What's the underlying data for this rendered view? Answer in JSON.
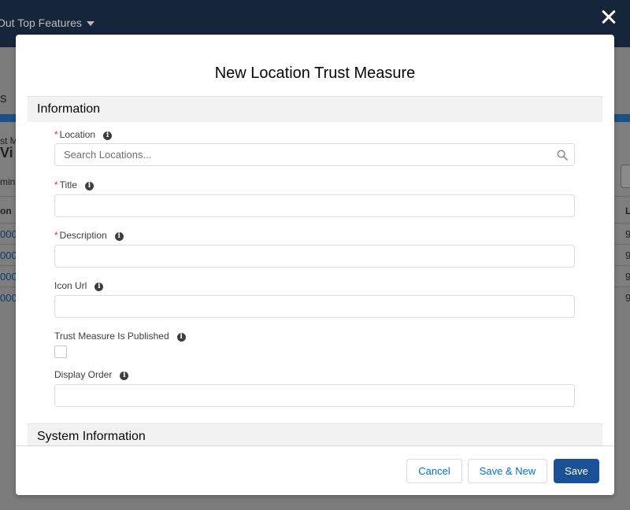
{
  "background": {
    "nav_label": "Out Top Features",
    "page_fragment_s": "s",
    "list_fragment_small": "st M",
    "list_fragment_large": "Vi",
    "list_fragment_filter": "min",
    "column_fragment_left": "on",
    "column_fragment_right": "L",
    "row_prefixes": [
      "000",
      "000",
      "000",
      "000"
    ],
    "row_suffixes": [
      "9",
      "9",
      "9",
      "9"
    ]
  },
  "modal": {
    "title": "New Location Trust Measure",
    "sections": {
      "information": "Information",
      "system_information": "System Information"
    },
    "fields": {
      "location": {
        "label": "Location",
        "required": "*",
        "placeholder": "Search Locations...",
        "value": ""
      },
      "title": {
        "label": "Title",
        "required": "*",
        "value": ""
      },
      "description": {
        "label": "Description",
        "required": "*",
        "value": ""
      },
      "icon_url": {
        "label": "Icon Url",
        "value": ""
      },
      "published": {
        "label": "Trust Measure Is Published",
        "checked": false
      },
      "display_order": {
        "label": "Display Order",
        "value": ""
      }
    },
    "info_glyph": "i",
    "footer": {
      "cancel": "Cancel",
      "save_new": "Save & New",
      "save": "Save"
    }
  },
  "colors": {
    "brand": "#1b5297",
    "header": "#16253a",
    "required": "#c23934",
    "link": "#0070d2"
  },
  "icons": [
    "close-icon",
    "search-icon",
    "info-icon",
    "chevron-down-icon"
  ]
}
